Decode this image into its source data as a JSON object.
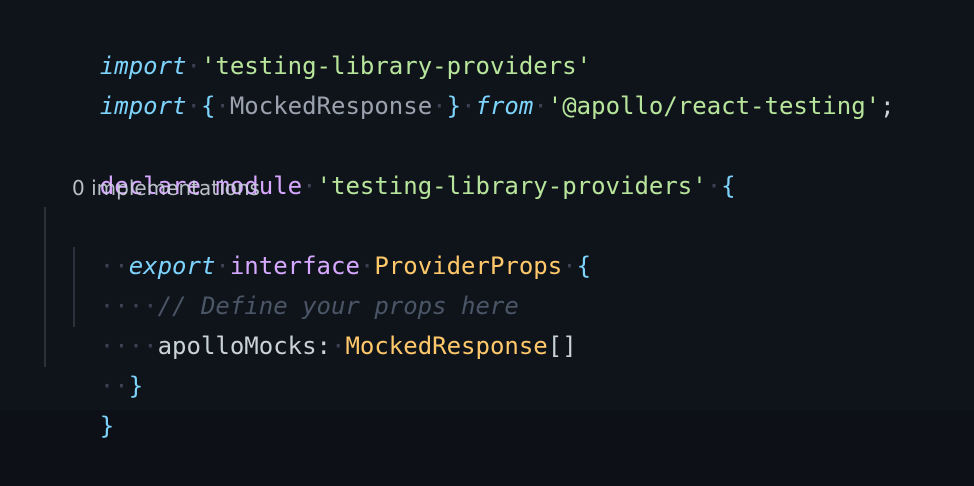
{
  "editor": {
    "line1": {
      "import_kw": "import",
      "module": "'testing-library-providers'"
    },
    "line2": {
      "import_kw": "import",
      "open_brace": "{",
      "name": "MockedResponse",
      "close_brace": "}",
      "from_kw": "from",
      "module": "'@apollo/react-testing'",
      "semicolon": ";"
    },
    "line4": {
      "declare_kw": "declare",
      "module_kw": "module",
      "module": "'testing-library-providers'",
      "open_brace": "{"
    },
    "codelens": "0 implementations",
    "line5": {
      "export_kw": "export",
      "interface_kw": "interface",
      "name": "ProviderProps",
      "open_brace": "{"
    },
    "line6": {
      "comment": "// Define your props here"
    },
    "line7": {
      "prop": "apolloMocks",
      "colon": ":",
      "type": "MockedResponse",
      "brackets": "[]"
    },
    "line8": {
      "close_brace": "}"
    },
    "line9": {
      "close_brace": "}"
    }
  }
}
